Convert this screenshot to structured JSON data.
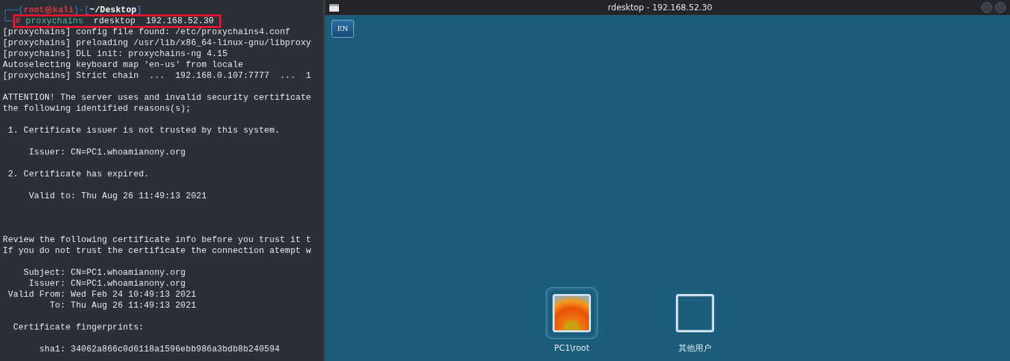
{
  "terminal": {
    "prompt_line": [
      {
        "text": "┌──(",
        "kind": "frame"
      },
      {
        "text": "root㉿kali",
        "kind": "user"
      },
      {
        "text": ")-[",
        "kind": "frame"
      },
      {
        "text": "~/Desktop",
        "kind": "path"
      },
      {
        "text": "]",
        "kind": "frame"
      }
    ],
    "command_line": {
      "highlighted": true,
      "segments": [
        {
          "text": "└─",
          "kind": "frame"
        },
        {
          "text": "#",
          "kind": "user"
        },
        {
          "text": " proxychains",
          "kind": "command"
        },
        {
          "text": "  rdesktop  192.168.52.30",
          "kind": "plain"
        }
      ]
    },
    "lines": [
      {
        "text": "[proxychains] config file found: /etc/proxychains4.conf",
        "kind": "line"
      },
      {
        "text": "[proxychains] preloading /usr/lib/x86_64-linux-gnu/libproxy",
        "kind": "line"
      },
      {
        "text": "[proxychains] DLL init: proxychains-ng 4.15",
        "kind": "line"
      },
      {
        "text": "Autoselecting keyboard map 'en-us' from locale",
        "kind": "line"
      },
      {
        "text": "[proxychains] Strict chain  ...  192.168.0.107:7777  ...  1",
        "kind": "line"
      },
      {
        "text": "ATTENTION! The server uses and invalid security certificate",
        "kind": "spaced"
      },
      {
        "text": "the following identified reasons(s);",
        "kind": "line"
      },
      {
        "text": " 1. Certificate issuer is not trusted by this system.",
        "kind": "spaced"
      },
      {
        "text": "     Issuer: CN=PC1.whoamianony.org",
        "kind": "spaced"
      },
      {
        "text": " 2. Certificate has expired.",
        "kind": "spaced"
      },
      {
        "text": "     Valid to: Thu Aug 26 11:49:13 2021",
        "kind": "spaced"
      },
      {
        "text": "Review the following certificate info before you trust it t",
        "kind": "section"
      },
      {
        "text": "If you do not trust the certificate the connection atempt w",
        "kind": "line"
      },
      {
        "text": "    Subject: CN=PC1.whoamianony.org",
        "kind": "spaced"
      },
      {
        "text": "     Issuer: CN=PC1.whoamianony.org",
        "kind": "line"
      },
      {
        "text": " Valid From: Wed Feb 24 10:49:13 2021",
        "kind": "line"
      },
      {
        "text": "         To: Thu Aug 26 11:49:13 2021",
        "kind": "line"
      },
      {
        "text": "  Certificate fingerprints:",
        "kind": "spaced"
      },
      {
        "text": "       sha1: 34062a866c0d6118a1596ebb986a3bdb8b240594",
        "kind": "spaced"
      }
    ]
  },
  "remote_window": {
    "title": "rdesktop - 192.168.52.30",
    "language_button": "EN",
    "users": [
      {
        "name": "PC1\\root",
        "kind": "photo",
        "selected": true
      },
      {
        "name": "其他用户",
        "kind": "blank",
        "selected": false
      }
    ]
  }
}
